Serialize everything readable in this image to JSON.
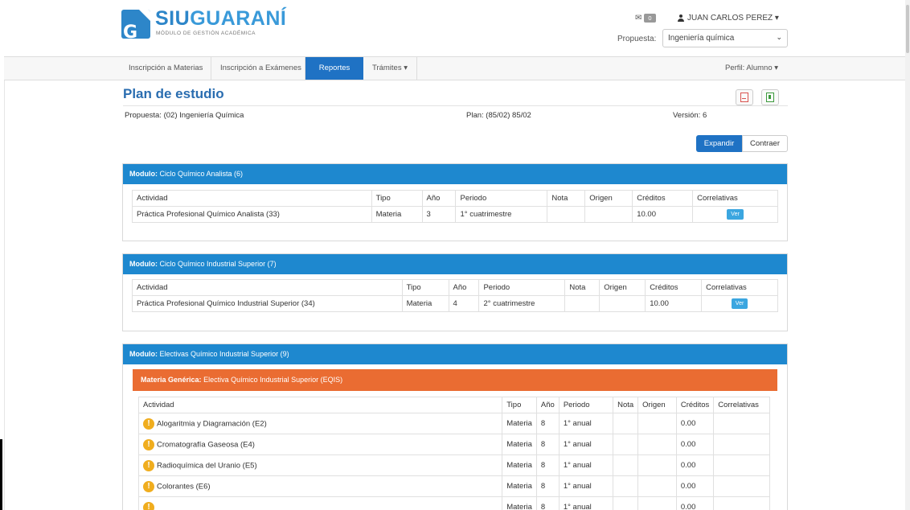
{
  "header": {
    "brand_siu": "SIU",
    "brand_guarani": "GUARANÍ",
    "brand_subtitle": "MÓDULO DE GESTIÓN ACADÉMICA",
    "mail_icon": "envelope-icon",
    "mail_count": "0",
    "user_name": "JUAN CARLOS PEREZ ▾",
    "propuesta_label": "Propuesta:",
    "propuesta_value": "Ingeniería química"
  },
  "nav": {
    "tabs": [
      {
        "label": "Inscripción a Materias"
      },
      {
        "label": "Inscripción a Exámenes"
      },
      {
        "label": "Reportes",
        "active": true
      },
      {
        "label": "Trámites ▾"
      }
    ],
    "profile": "Perfil: Alumno ▾"
  },
  "page": {
    "title": "Plan de estudio",
    "propuesta": "Propuesta: (02) Ingeniería Química",
    "plan": "Plan: (85/02) 85/02",
    "version": "Versión: 6",
    "expandir": "Expandir",
    "contraer": "Contraer",
    "pdf_icon": "pdf-icon",
    "excel_icon": "excel-icon"
  },
  "headers": {
    "actividad": "Actividad",
    "tipo": "Tipo",
    "anio": "Año",
    "periodo": "Periodo",
    "nota": "Nota",
    "origen": "Origen",
    "creditos": "Créditos",
    "correlativas": "Correlativas"
  },
  "modules": [
    {
      "prefix": "Modulo:",
      "name": "Ciclo Químico Analista (6)",
      "rows": [
        {
          "actividad": "Práctica Profesional Químico Analista (33)",
          "tipo": "Materia",
          "anio": "3",
          "periodo": "1° cuatrimestre",
          "nota": "",
          "origen": "",
          "creditos": "10.00",
          "ver": "Ver"
        }
      ]
    },
    {
      "prefix": "Modulo:",
      "name": "Ciclo Químico Industrial Superior (7)",
      "rows": [
        {
          "actividad": "Práctica Profesional Químico Industrial Superior (34)",
          "tipo": "Materia",
          "anio": "4",
          "periodo": "2° cuatrimestre",
          "nota": "",
          "origen": "",
          "creditos": "10.00",
          "ver": "Ver"
        }
      ]
    },
    {
      "prefix": "Modulo:",
      "name": "Electivas Químico Industrial Superior (9)",
      "generic_prefix": "Materia Genérica:",
      "generic_name": "Electiva Químico Industrial Superior (EQIS)",
      "rows": [
        {
          "actividad": "Alogaritmia y Diagramación (E2)",
          "tipo": "Materia",
          "anio": "8",
          "periodo": "1° anual",
          "creditos": "0.00"
        },
        {
          "actividad": "Cromatografía Gaseosa (E4)",
          "tipo": "Materia",
          "anio": "8",
          "periodo": "1° anual",
          "creditos": "0.00"
        },
        {
          "actividad": "Radioquímica del Uranio (E5)",
          "tipo": "Materia",
          "anio": "8",
          "periodo": "1° anual",
          "creditos": "0.00"
        },
        {
          "actividad": "Colorantes (E6)",
          "tipo": "Materia",
          "anio": "8",
          "periodo": "1° anual",
          "creditos": "0.00"
        },
        {
          "actividad": "",
          "tipo": "Materia",
          "anio": "8",
          "periodo": "1° anual",
          "creditos": "0.00"
        }
      ]
    }
  ],
  "colors": {
    "primary": "#1f72c4",
    "module_header": "#1e88cf",
    "generic_header": "#ea6c32",
    "warning": "#f0ad1e"
  }
}
